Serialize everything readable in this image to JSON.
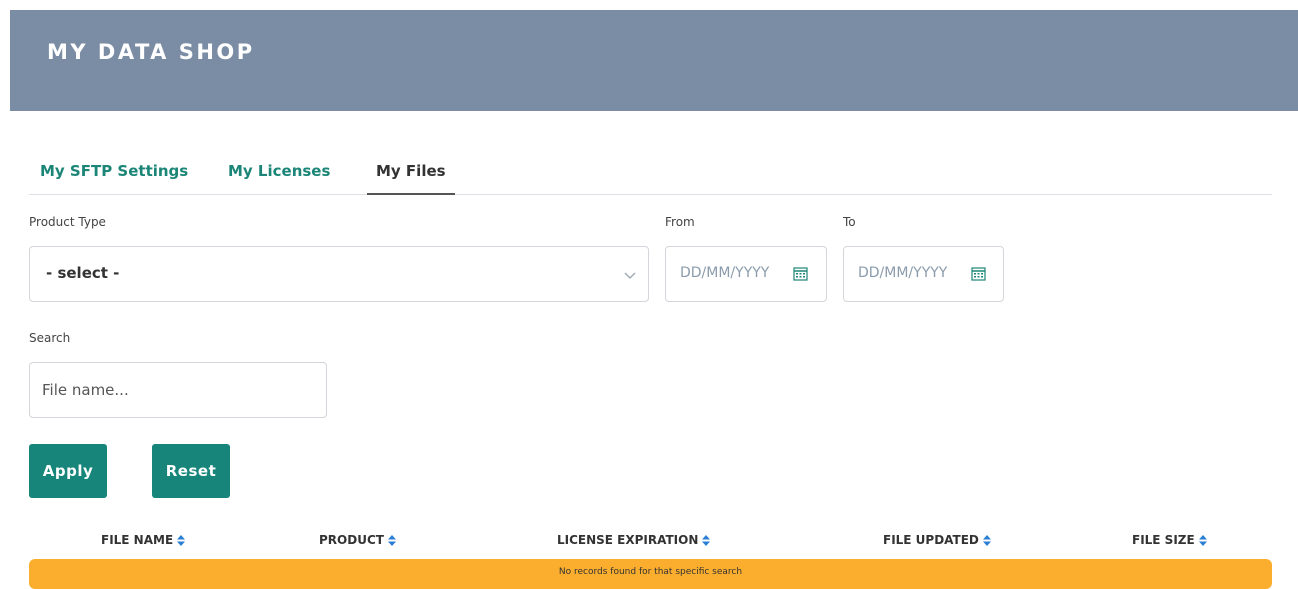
{
  "header": {
    "title": "MY DATA SHOP"
  },
  "tabs": [
    {
      "label": "My SFTP Settings",
      "active": false
    },
    {
      "label": "My Licenses",
      "active": false
    },
    {
      "label": "My Files",
      "active": true
    }
  ],
  "filters": {
    "product_type": {
      "label": "Product Type",
      "value": "- select -"
    },
    "from": {
      "label": "From",
      "placeholder": "DD/MM/YYYY"
    },
    "to": {
      "label": "To",
      "placeholder": "DD/MM/YYYY"
    },
    "search": {
      "label": "Search",
      "placeholder": "File name..."
    }
  },
  "buttons": {
    "apply": "Apply",
    "reset": "Reset"
  },
  "table": {
    "columns": [
      "FILE NAME",
      "PRODUCT",
      "LICENSE EXPIRATION",
      "FILE UPDATED",
      "FILE SIZE"
    ],
    "empty_message": "No records found for that specific search"
  },
  "colors": {
    "banner": "#7a8da5",
    "accent": "#17857a",
    "sort_icon": "#2a7fd4",
    "notice": "#fbae2e"
  }
}
